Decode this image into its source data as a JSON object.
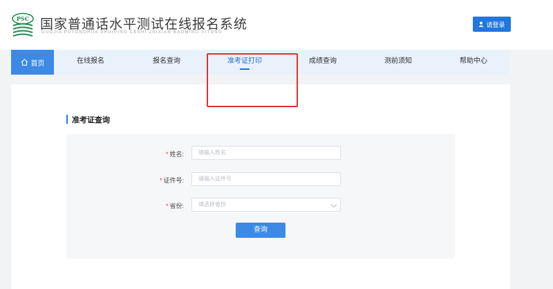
{
  "header": {
    "logo_text": "PSC",
    "title": "国家普通话水平测试在线报名系统",
    "subtitle": "GUOJIA PUTONGHUA SHUIPING CESHI ZAIXIAN BAOMING XITONG",
    "login_label": "请登录"
  },
  "nav": {
    "items": [
      {
        "label": "首页",
        "icon": "home-icon"
      },
      {
        "label": "在线报名"
      },
      {
        "label": "报名查询"
      },
      {
        "label": "准考证打印"
      },
      {
        "label": "成绩查询"
      },
      {
        "label": "测前须知"
      },
      {
        "label": "帮助中心"
      }
    ],
    "active_index": 3
  },
  "section": {
    "title": "准考证查询"
  },
  "form": {
    "name_label": "姓名:",
    "name_placeholder": "请输入姓名",
    "id_label": "证件号:",
    "id_placeholder": "请输入证件号",
    "province_label": "省份:",
    "province_placeholder": "请选择省份",
    "submit_label": "查询"
  },
  "colors": {
    "accent": "#2277dd",
    "nav_bg": "#e9f1fb",
    "annotation": "#d93333"
  }
}
